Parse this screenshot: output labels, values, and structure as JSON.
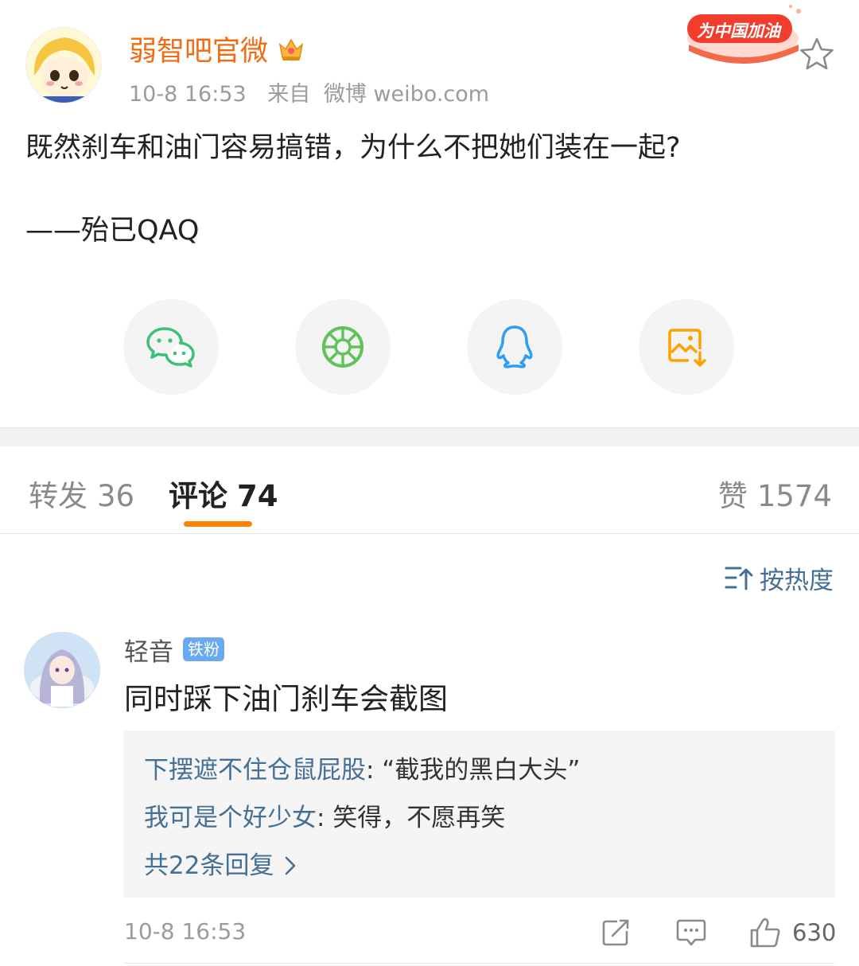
{
  "post": {
    "author": "弱智吧官微",
    "time": "10-8 16:53",
    "source_prefix": "来自",
    "source": "微博 weibo.com",
    "badge_text": "为中国加油",
    "body_line1": "既然刹车和油门容易搞错，为什么不把她们装在一起?",
    "body_line2": "——殆已QAQ"
  },
  "share": {
    "items": [
      "wechat-icon",
      "moments-icon",
      "qq-icon",
      "save-image-icon"
    ]
  },
  "tabs": {
    "repost_label": "转发",
    "repost_count": "36",
    "comment_label": "评论",
    "comment_count": "74",
    "like_label": "赞",
    "like_count": "1574"
  },
  "sort": {
    "label": "按热度"
  },
  "comment": {
    "user": "轻音",
    "badge": "铁粉",
    "text": "同时踩下油门刹车会截图",
    "replies": [
      {
        "user": "下摆遮不住仓鼠屁股",
        "text": ": “截我的黑白大头”"
      },
      {
        "user": "我可是个好少女",
        "text": ": 笑得，不愿再笑"
      }
    ],
    "more_replies": "共22条回复",
    "time": "10-8 16:53",
    "like_count": "630"
  },
  "colors": {
    "author": "#f26b11",
    "link": "#456f94",
    "accent": "#ff8200",
    "wechat": "#3ec07b",
    "moments": "#5fc35a",
    "qq": "#2f9df4",
    "save": "#ffa200"
  }
}
